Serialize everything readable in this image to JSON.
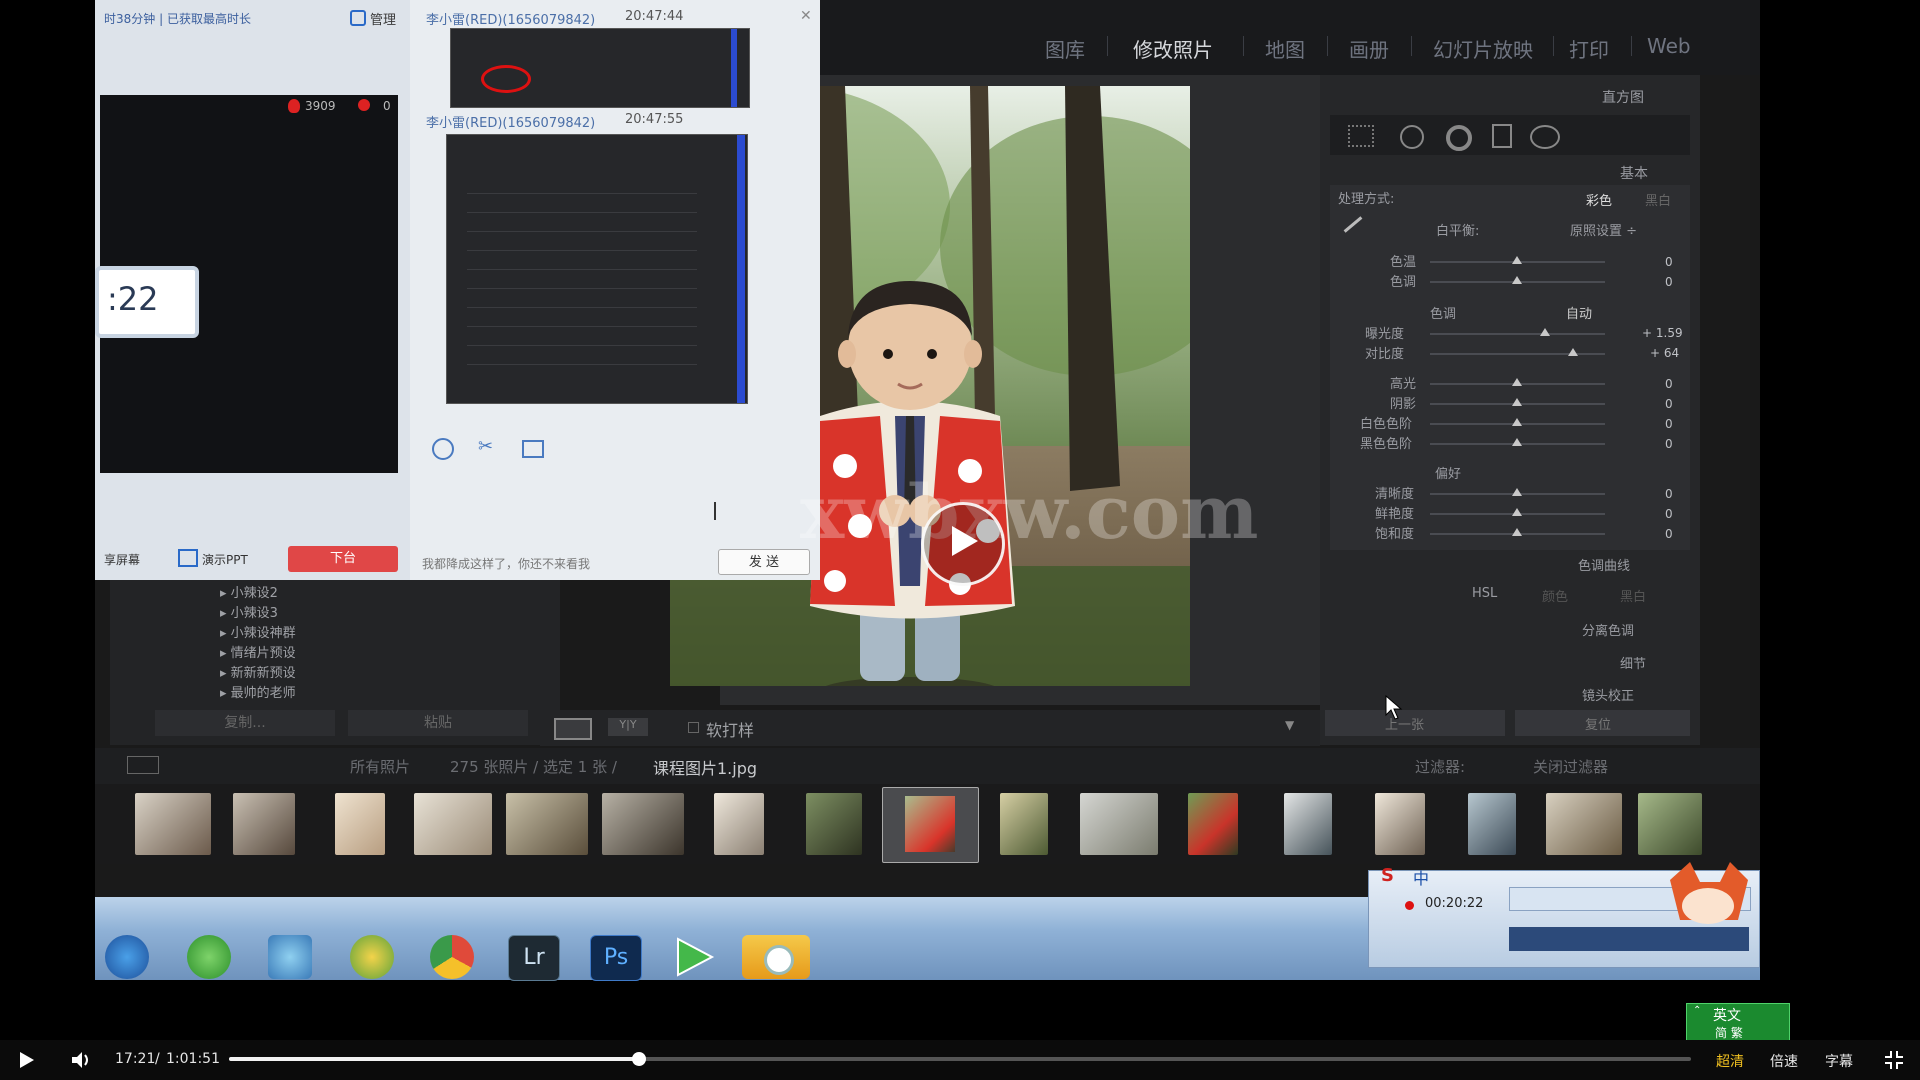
{
  "lightroom": {
    "modules": [
      "图库",
      "修改照片",
      "地图",
      "画册",
      "幻灯片放映",
      "打印",
      "Web"
    ],
    "active_module": "修改照片",
    "panel_headers": {
      "histogram": "直方图",
      "basic": "基本"
    },
    "basic": {
      "treatment_label": "处理方式:",
      "treatment_color": "彩色",
      "treatment_bw": "黑白",
      "wb_label": "白平衡:",
      "wb_value": "原照设置 ÷",
      "temp": "色温",
      "tint": "色调",
      "tone_label": "色调",
      "auto": "自动",
      "exposure": "曝光度",
      "exposure_val": "+ 1.59",
      "contrast": "对比度",
      "contrast_val": "+ 64",
      "highlights": "高光",
      "shadows": "阴影",
      "whites": "白色色阶",
      "blacks": "黑色色阶",
      "presence_label": "偏好",
      "clarity": "清晰度",
      "vibrance": "鲜艳度",
      "saturation": "饱和度",
      "zero": "0"
    },
    "collapsed_panels": {
      "tone_curve": "色调曲线",
      "hsl": "HSL",
      "hsl_color": "颜色",
      "hsl_bw": "黑白",
      "split": "分离色调",
      "detail": "细节",
      "lens": "镜头校正"
    },
    "right_buttons": {
      "prev": "上一张",
      "reset": "复位"
    },
    "presets": [
      "小辣设2",
      "小辣设3",
      "小辣设神群",
      "情绪片预设",
      "新新新预设",
      "最帅的老师"
    ],
    "left_buttons": {
      "copy": "复制...",
      "paste": "粘贴"
    },
    "toolbar": {
      "softproof": "软打样"
    },
    "filmstrip_bar": {
      "path": "所有照片",
      "count": "275 张照片 / 选定 1 张 /",
      "filename": "课程图片1.jpg",
      "filter_label": "过滤器:",
      "filter_off": "关闭过滤器"
    }
  },
  "chat": {
    "top_left_text": "时38分钟 | 已获取最高时长",
    "manage": "管理",
    "viewers": "3909",
    "flowers": "0",
    "timer": ":22",
    "msg1_sender": "李小雷(RED)(1656079842)",
    "msg1_time": "20:47:44",
    "msg2_sender": "李小雷(RED)(1656079842)",
    "msg2_time": "20:47:55",
    "share_screen": "享屏幕",
    "show_ppt": "演示PPT",
    "leave_button": "下台",
    "input_text": "我都降成这样了，你还不来看我",
    "send_button": "发 送"
  },
  "watermark": "xwbxw.com",
  "taskbar": {
    "apps": [
      "start",
      "ie",
      "qq-browser",
      "settings",
      "chrome",
      "lightroom",
      "photoshop",
      "media-player",
      "camera"
    ],
    "lr_label": "Lr",
    "ps_label": "Ps",
    "ime_mode": "中",
    "rec_time": "00:20:22",
    "ime_lang": "英文",
    "ime_simplified": "简 繁"
  },
  "player": {
    "current_time": "17:21",
    "separator": "/",
    "duration": "1:01:51",
    "progress": 0.2805,
    "quality": "超清",
    "speed": "倍速",
    "subtitle": "字幕"
  }
}
